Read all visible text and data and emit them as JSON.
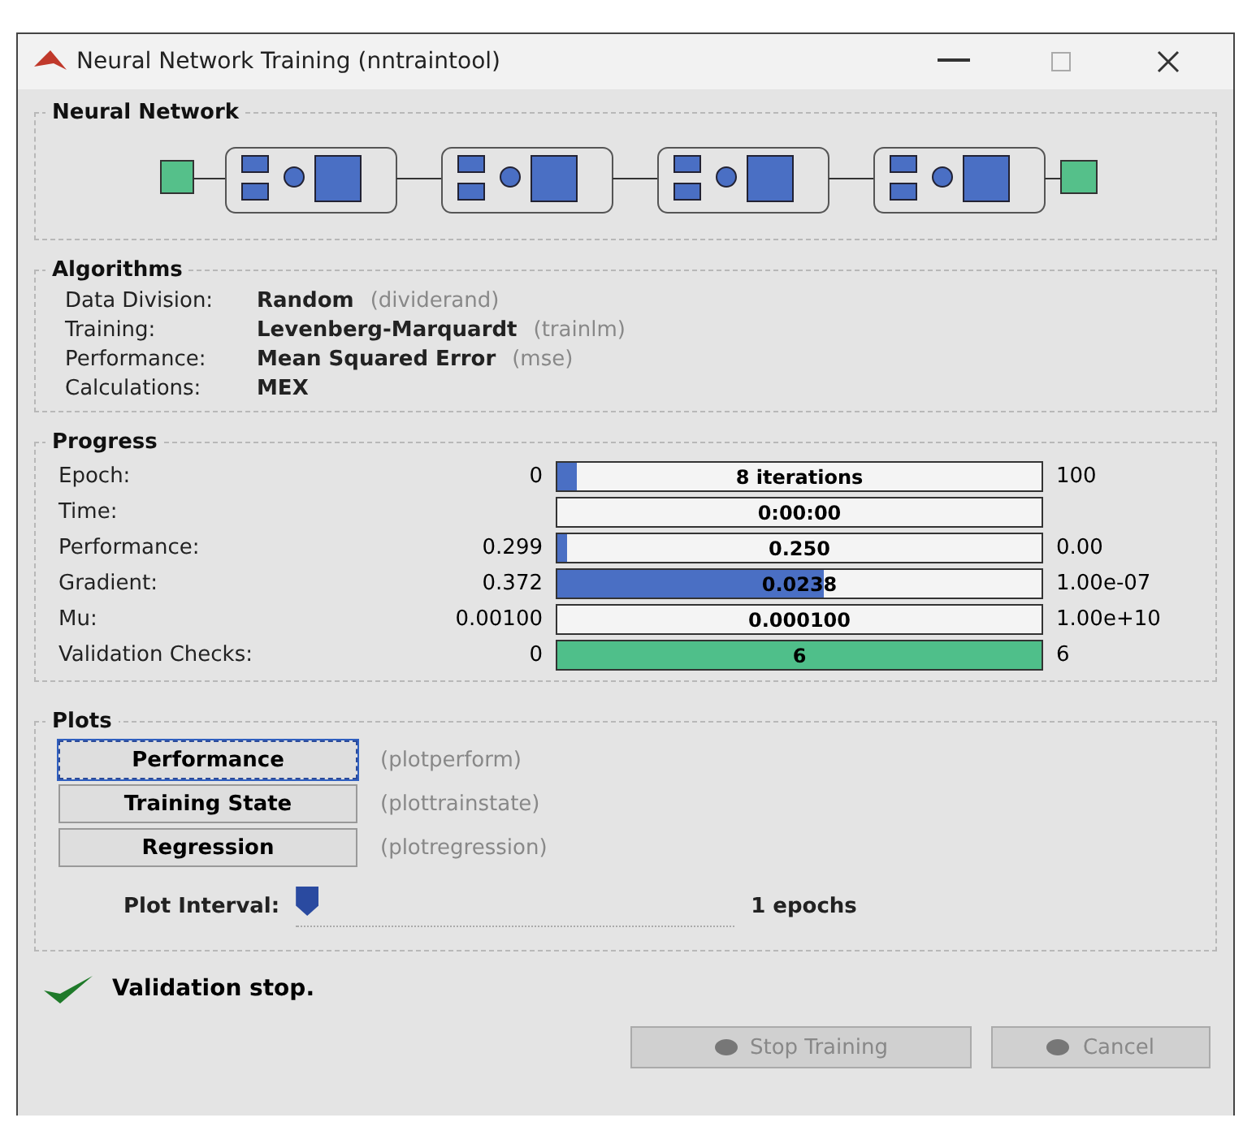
{
  "window": {
    "title": "Neural Network Training (nntraintool)"
  },
  "neural_network": {
    "title": "Neural Network"
  },
  "algorithms": {
    "title": "Algorithms",
    "rows": [
      {
        "label": "Data Division:",
        "value": "Random",
        "function": "(dividerand)"
      },
      {
        "label": "Training:",
        "value": "Levenberg-Marquardt",
        "function": "(trainlm)"
      },
      {
        "label": "Performance:",
        "value": "Mean Squared Error",
        "function": "(mse)"
      },
      {
        "label": "Calculations:",
        "value": "MEX"
      }
    ]
  },
  "progress": {
    "title": "Progress",
    "rows": [
      {
        "label": "Epoch:",
        "start": "0",
        "reading": "8 iterations",
        "end": "100",
        "level": 0.04,
        "color": "#4a6fc4"
      },
      {
        "label": "Time:",
        "reading": "0:00:00"
      },
      {
        "label": "Performance:",
        "start": "0.299",
        "reading": "0.250",
        "end": "0.00",
        "level": 0.02,
        "color": "#4a6fc4"
      },
      {
        "label": "Gradient:",
        "start": "0.372",
        "reading": "0.0238",
        "end": "1.00e-07",
        "level": 0.55,
        "color": "#4a6fc4"
      },
      {
        "label": "Mu:",
        "start": "0.00100",
        "reading": "0.000100",
        "end": "1.00e+10"
      },
      {
        "label": "Validation Checks:",
        "start": "0",
        "reading": "6",
        "end": "6",
        "level": 1,
        "color": "#4fbf8a"
      }
    ]
  },
  "plots": {
    "title": "Plots",
    "buttons": [
      {
        "label": "Performance",
        "function": "(plotperform)",
        "focused": true
      },
      {
        "label": "Training State",
        "function": "(plottrainstate)",
        "focused": false
      },
      {
        "label": "Regression",
        "function": "(plotregression)",
        "focused": false
      }
    ],
    "interval": {
      "label": "Plot Interval:",
      "level": 0,
      "reading": "1 epochs"
    }
  },
  "status": {
    "text": "Validation stop.",
    "ok": true
  },
  "buttons": [
    {
      "label": "Stop Training",
      "disabled": true
    },
    {
      "label": "Cancel",
      "disabled": true
    }
  ]
}
